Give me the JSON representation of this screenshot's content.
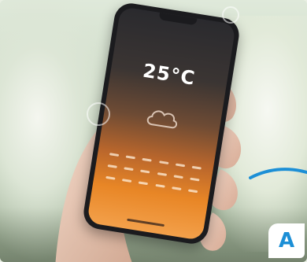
{
  "phone": {
    "temperature": "25°C"
  },
  "badge": {
    "label": "A"
  },
  "colors": {
    "accent_blue": "#1c8fd6",
    "screen_orange": "#e88626"
  }
}
